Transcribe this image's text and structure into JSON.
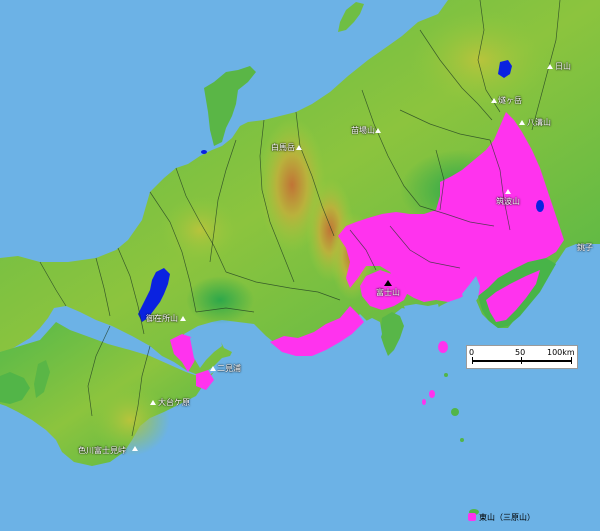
{
  "map": {
    "colors": {
      "sea": "#6cb2e6",
      "lowland": "#48b848",
      "upland": "#9cc83c",
      "mountain": "#c87838",
      "highlight": "#ff33ee",
      "lake": "#0a22e0"
    },
    "labels": [
      {
        "id": "nikko",
        "text": "日山",
        "marker": "white"
      },
      {
        "id": "hiuchi",
        "text": "燧ヶ岳",
        "marker": "white"
      },
      {
        "id": "yamizo",
        "text": "八溝山",
        "marker": "white"
      },
      {
        "id": "nantai",
        "text": "苗場山",
        "marker": "white"
      },
      {
        "id": "shirouma",
        "text": "白馬岳",
        "marker": "white"
      },
      {
        "id": "tsukuba",
        "text": "筑波山",
        "marker": "white"
      },
      {
        "id": "choshi",
        "text": "銚子",
        "marker": "none"
      },
      {
        "id": "fuji",
        "text": "富士山",
        "marker": "black"
      },
      {
        "id": "gozaisho",
        "text": "御在所山",
        "marker": "white"
      },
      {
        "id": "futami",
        "text": "二見浦",
        "marker": "white"
      },
      {
        "id": "odaigahara",
        "text": "大台ケ原",
        "marker": "white"
      },
      {
        "id": "irokawa",
        "text": "色川富士見峠",
        "marker": "white"
      }
    ],
    "scale": {
      "ticks": [
        "0",
        "50",
        "100km"
      ]
    },
    "legend": {
      "text": "東山（三原山）"
    }
  }
}
